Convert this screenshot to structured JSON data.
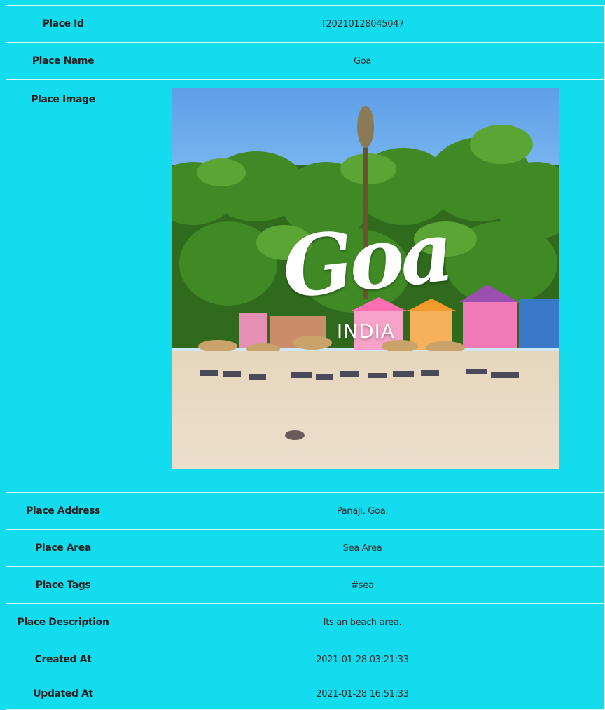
{
  "place_details": {
    "rows": [
      {
        "label": "Place Id",
        "value": "T20210128045047"
      },
      {
        "label": "Place Name",
        "value": "Goa"
      },
      {
        "label": "Place Image",
        "image": {
          "title_text": "Goa",
          "subtitle_text": "INDIA"
        }
      },
      {
        "label": "Place Address",
        "value": "Panaji, Goa."
      },
      {
        "label": "Place Area",
        "value": "Sea Area"
      },
      {
        "label": "Place Tags",
        "value": "#sea"
      },
      {
        "label": "Place Description",
        "value": "Its an beach area."
      },
      {
        "label": "Created At",
        "value": "2021-01-28 03:21:33"
      },
      {
        "label": "Updated At",
        "value": "2021-01-28 16:51:33"
      }
    ]
  },
  "colors": {
    "background": "#12dced",
    "grid_line": "#d8f6f9",
    "label_text": "#222222",
    "value_text": "#303030"
  }
}
